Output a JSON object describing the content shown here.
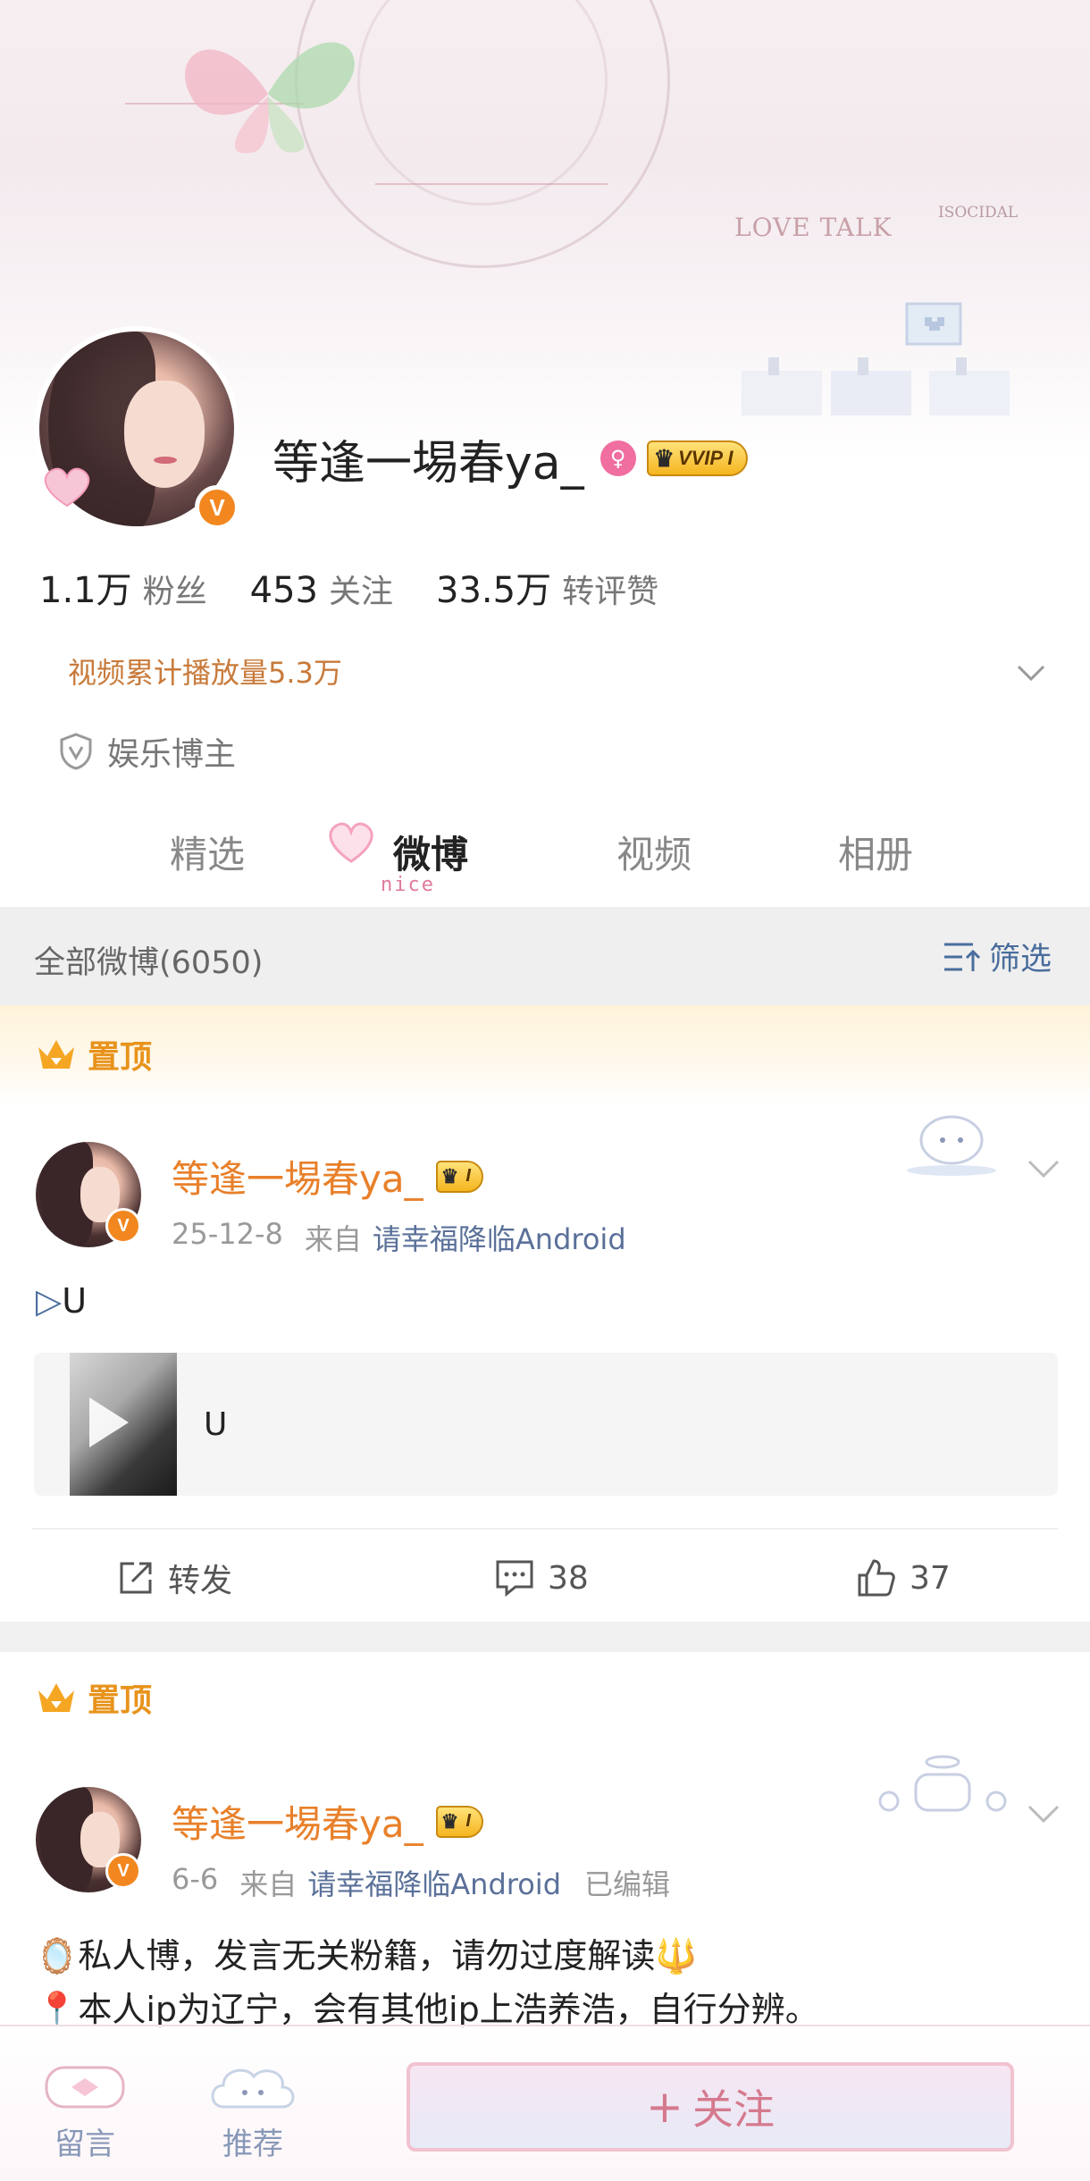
{
  "banner": {
    "love_talk": "LOVE TALK",
    "isocidal": "ISOCIDAL"
  },
  "profile": {
    "name": "等逢一埸春ya_",
    "vip_label": "VVIP I",
    "verified_mark": "V",
    "stats": [
      {
        "num": "1.1万",
        "label": "粉丝"
      },
      {
        "num": "453",
        "label": "关注"
      },
      {
        "num": "33.5万",
        "label": "转评赞"
      }
    ],
    "play_count": "视频累计播放量5.3万",
    "tag": "娱乐博主"
  },
  "tabs": [
    {
      "label": "精选",
      "active": false
    },
    {
      "label": "微博",
      "active": true
    },
    {
      "label": "视频",
      "active": false
    },
    {
      "label": "相册",
      "active": false
    }
  ],
  "tab_decoration": "nice",
  "filter_bar": {
    "all_label": "全部微博(6050)",
    "filter_label": "筛选"
  },
  "posts": [
    {
      "pinned_label": "置顶",
      "author": "等逢一埸春ya_",
      "vip_label": "I",
      "date": "25-12-8",
      "from_label": "来自",
      "source": "请幸福降临Android",
      "text": "U",
      "media_title": "U",
      "repost_label": "转发",
      "comments": "38",
      "likes": "37"
    },
    {
      "pinned_label": "置顶",
      "author": "等逢一埸春ya_",
      "vip_label": "I",
      "date": "6-6",
      "from_label": "来自",
      "source": "请幸福降临Android",
      "edited": "已编辑",
      "line1": "私人博，发言无关粉籍，请勿过度解读",
      "line2": "本人ip为辽宁，会有其他ip上浩养浩，自行分辨。"
    }
  ],
  "bottom_bar": {
    "message_label": "留言",
    "recommend_label": "推荐",
    "follow_label": "关注"
  },
  "colors": {
    "accent_orange": "#e8802a",
    "link_blue": "#5a7099",
    "pin_gold": "#e8931c"
  }
}
